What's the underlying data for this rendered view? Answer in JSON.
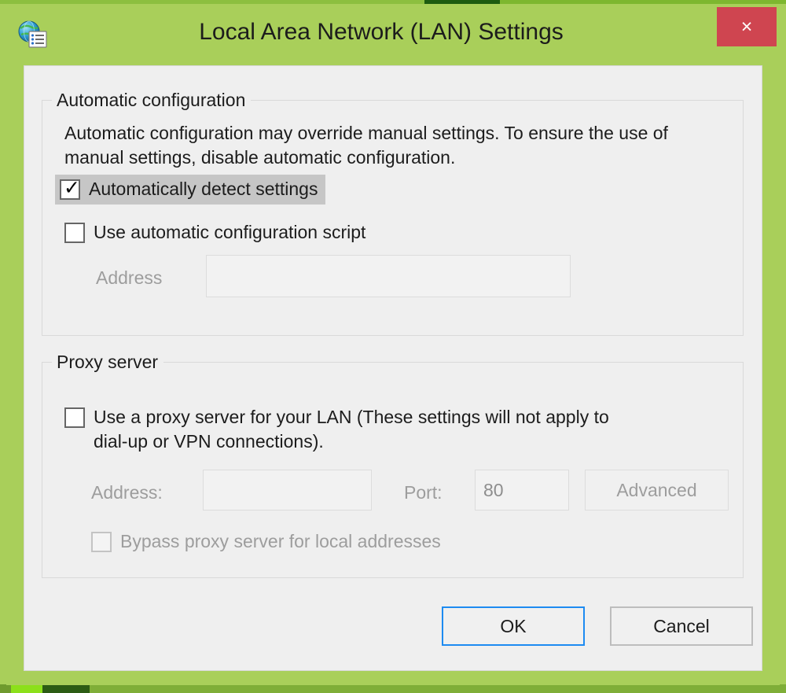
{
  "window": {
    "title": "Local Area Network (LAN) Settings",
    "icon": "internet-options-globe-icon",
    "close_label": "×",
    "frame_color": "#a9cf5a",
    "close_button_color": "#cf4550",
    "client_bg": "#efefef"
  },
  "automatic_configuration": {
    "legend": "Automatic configuration",
    "description": "Automatic configuration may override manual settings.  To ensure the use of manual settings, disable automatic configuration.",
    "auto_detect": {
      "label": "Automatically detect settings",
      "checked": true,
      "highlighted": true
    },
    "auto_script": {
      "label": "Use automatic configuration script",
      "checked": false
    },
    "address": {
      "label": "Address",
      "value": "",
      "placeholder": "",
      "disabled": true
    }
  },
  "proxy_server": {
    "legend": "Proxy server",
    "use_proxy": {
      "label": "Use a proxy server for your LAN (These settings will not apply to\ndial-up or VPN connections).",
      "checked": false
    },
    "address": {
      "label": "Address:",
      "value": "",
      "placeholder": "",
      "disabled": true
    },
    "port": {
      "label": "Port:",
      "value": "80",
      "disabled": true
    },
    "advanced_button": {
      "label": "Advanced",
      "disabled": true
    },
    "bypass": {
      "label": "Bypass proxy server for local addresses",
      "checked": false,
      "disabled": true
    }
  },
  "footer": {
    "ok_label": "OK",
    "cancel_label": "Cancel",
    "focus_color": "#1d8bf1"
  }
}
